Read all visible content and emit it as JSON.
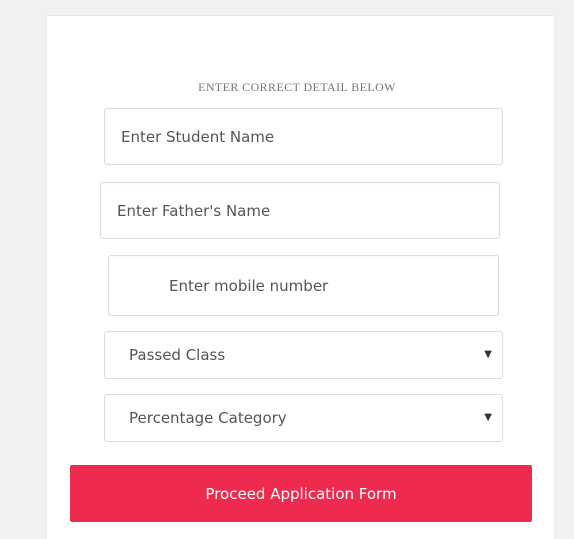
{
  "form": {
    "heading": "ENTER CORRECT DETAIL BELOW",
    "student_name": {
      "placeholder": "Enter Student Name",
      "value": ""
    },
    "father_name": {
      "placeholder": "Enter Father's Name",
      "value": ""
    },
    "mobile": {
      "placeholder": "Enter mobile number",
      "value": ""
    },
    "passed_class": {
      "selected": "Passed Class"
    },
    "percentage_category": {
      "selected": "Percentage Category"
    },
    "submit_label": "Proceed Application Form"
  },
  "colors": {
    "button": "#ee2b4f",
    "page_background": "#f1f1f1",
    "card_background": "#ffffff",
    "input_border": "#dcdcdc"
  },
  "icons": {
    "dropdown": "triangle-down"
  }
}
